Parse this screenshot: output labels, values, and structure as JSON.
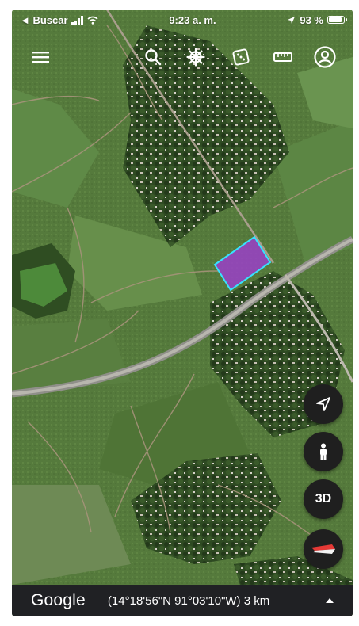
{
  "status_bar": {
    "back_app": "◄ Buscar",
    "time": "9:23 a. m.",
    "battery": "93 %",
    "battery_level": 0.93
  },
  "toolbar": {
    "icons": [
      "menu-icon",
      "search-icon",
      "voyager-icon",
      "feeling-lucky-dice-icon",
      "measure-ruler-icon",
      "account-icon"
    ]
  },
  "map_controls": {
    "locate": "navigation-arrow-icon",
    "street_view": "pegman-icon",
    "three_d_label": "3D",
    "compass": "compass-icon"
  },
  "bottom_bar": {
    "logo": "Google",
    "coordinates": "(14°18'56\"N 91°03'10\"W) 3 km"
  },
  "colors": {
    "polygon_fill": "#9b3fc8",
    "polygon_stroke": "#37e2ff",
    "bar_background": "#202124",
    "fab_background": "#1f1f1f"
  }
}
